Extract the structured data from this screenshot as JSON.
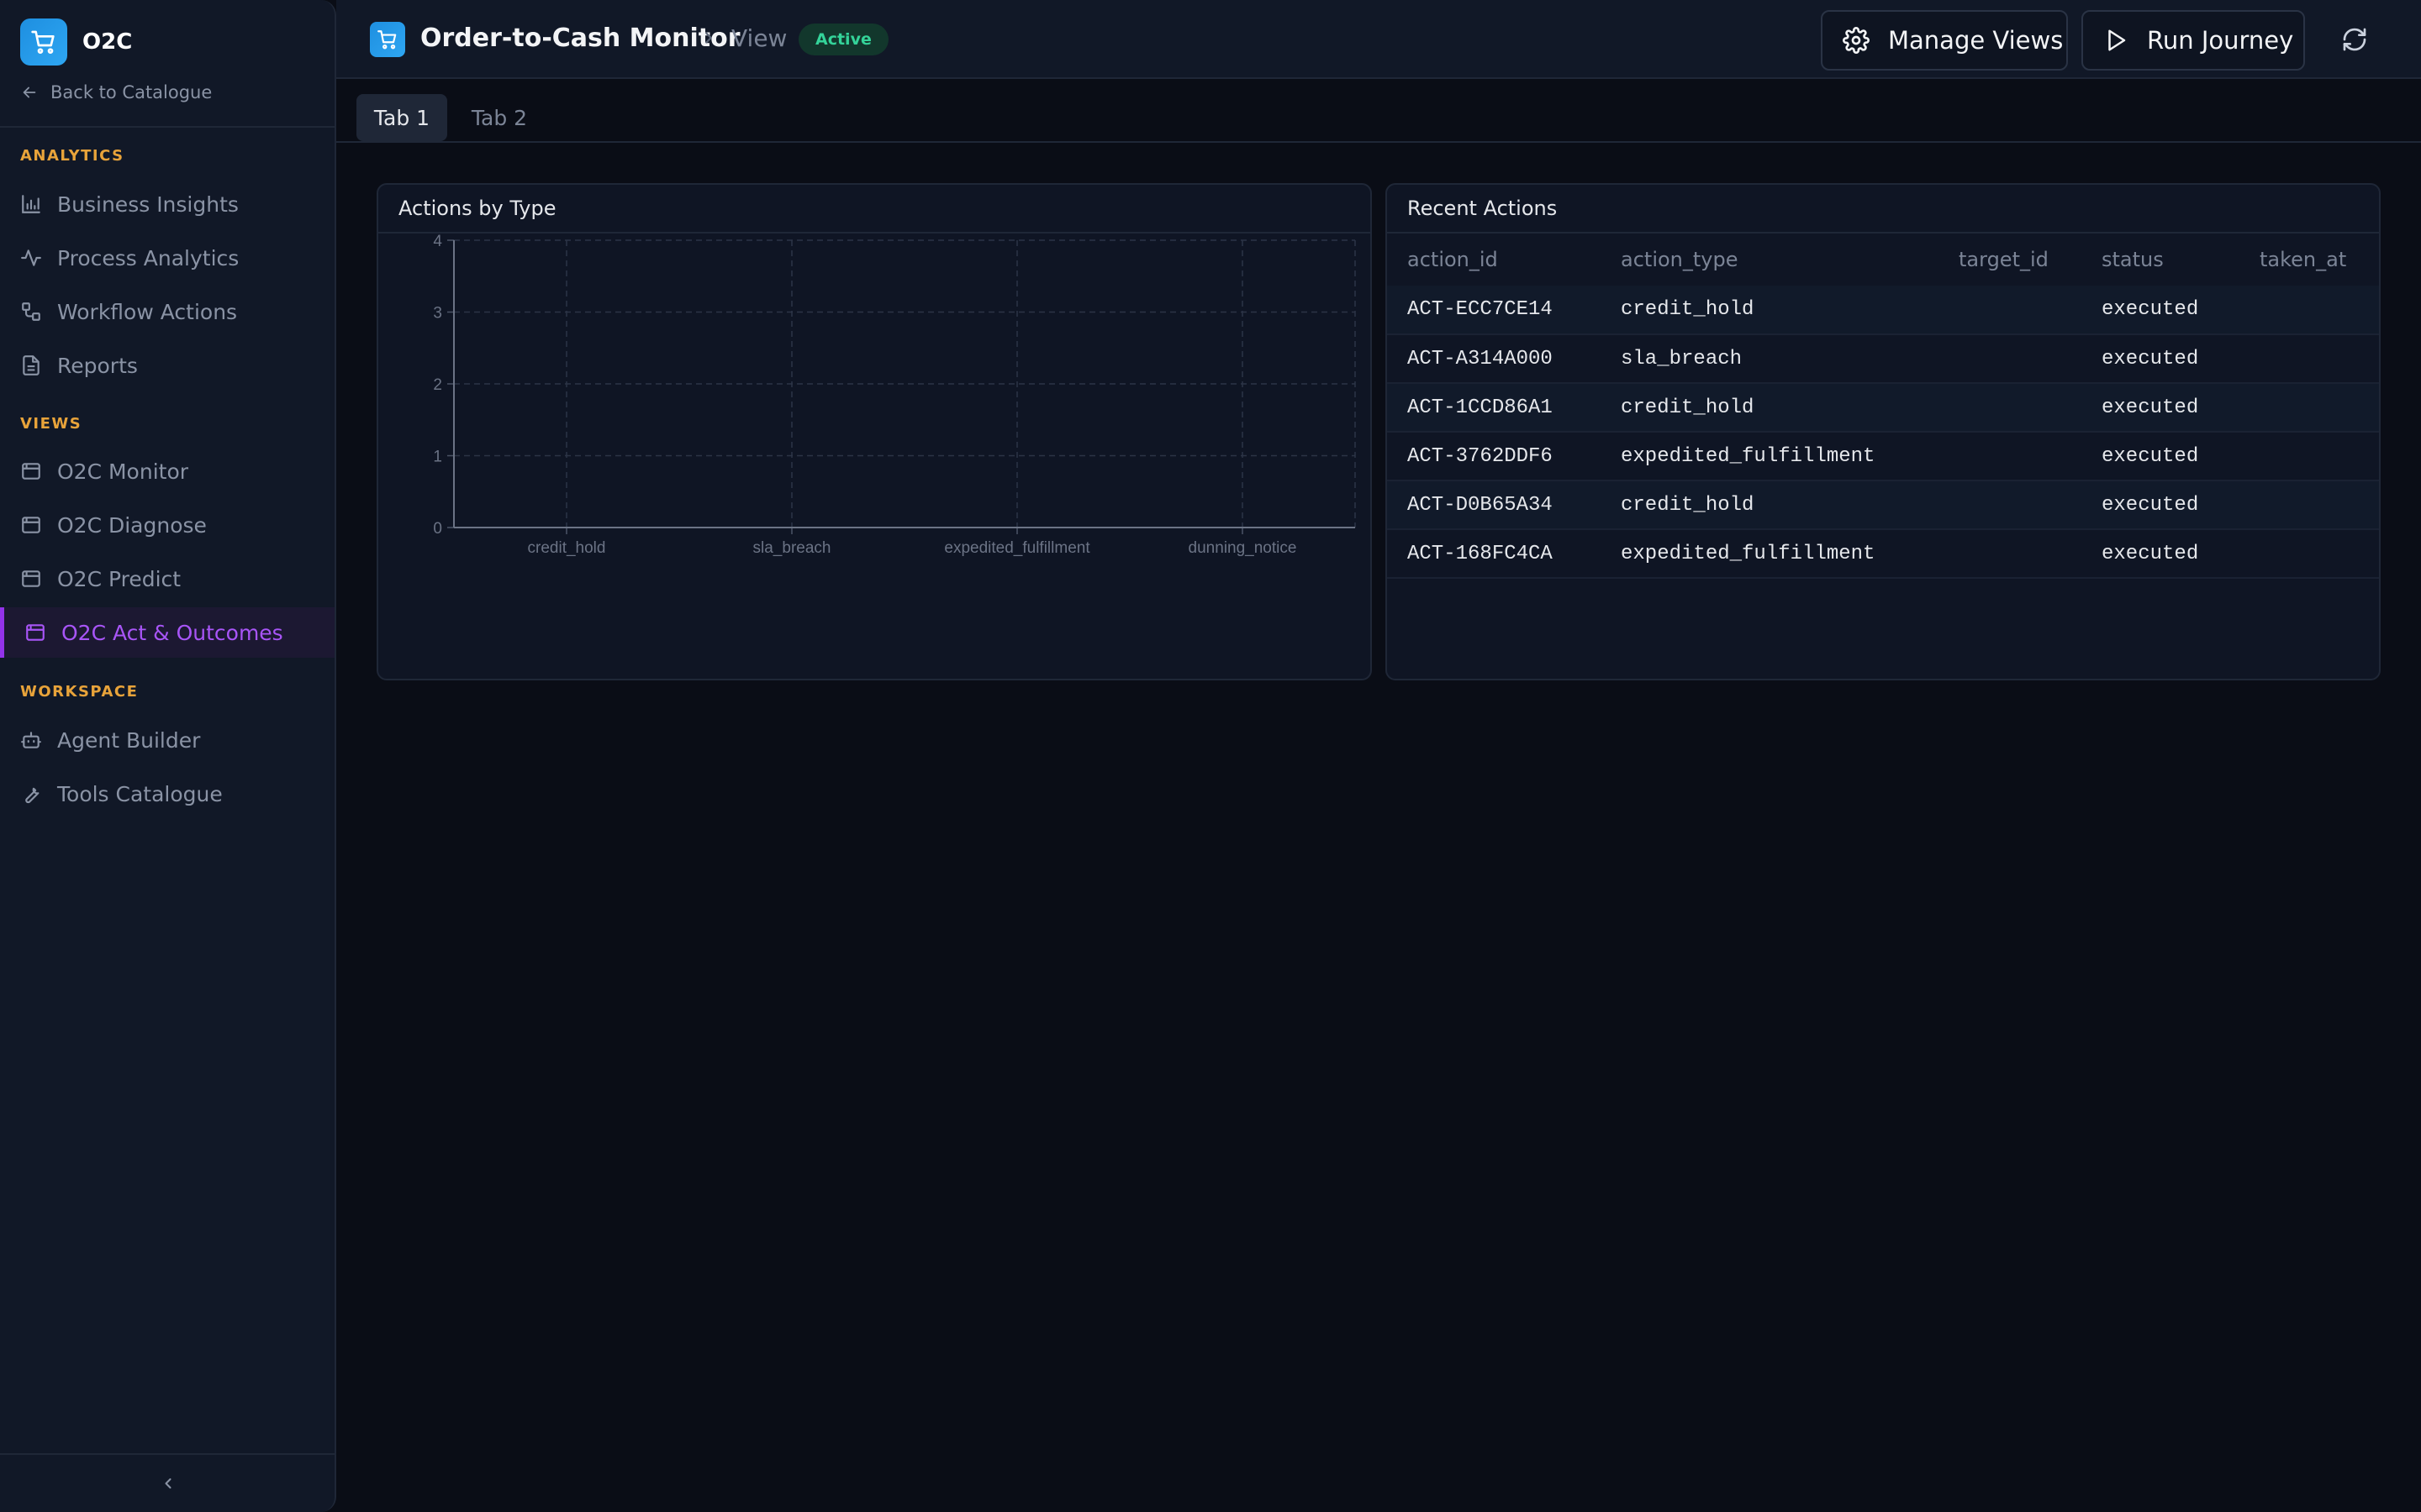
{
  "sidebar": {
    "brand": "O2C",
    "back_label": "Back to Catalogue",
    "sections": {
      "analytics": "ANALYTICS",
      "views": "VIEWS",
      "workspace": "WORKSPACE"
    },
    "analytics_items": [
      {
        "label": "Business Insights",
        "icon": "bar-chart-icon"
      },
      {
        "label": "Process Analytics",
        "icon": "activity-icon"
      },
      {
        "label": "Workflow Actions",
        "icon": "workflow-icon"
      },
      {
        "label": "Reports",
        "icon": "document-icon"
      }
    ],
    "view_items": [
      {
        "label": "O2C Monitor",
        "icon": "window-icon"
      },
      {
        "label": "O2C Diagnose",
        "icon": "window-icon"
      },
      {
        "label": "O2C Predict",
        "icon": "window-icon"
      },
      {
        "label": "O2C Act & Outcomes",
        "icon": "window-icon",
        "active": true
      }
    ],
    "workspace_items": [
      {
        "label": "Agent Builder",
        "icon": "bot-icon"
      },
      {
        "label": "Tools Catalogue",
        "icon": "wrench-icon"
      }
    ]
  },
  "header": {
    "title": "Order-to-Cash Monitor",
    "view_label": "View",
    "status_badge": "Active",
    "manage_views_label": "Manage Views",
    "run_journey_label": "Run Journey"
  },
  "tabs": [
    {
      "label": "Tab 1",
      "active": true
    },
    {
      "label": "Tab 2",
      "active": false
    }
  ],
  "chart_panel": {
    "title": "Actions by Type"
  },
  "chart_data": {
    "type": "bar",
    "title": "Actions by Type",
    "categories": [
      "credit_hold",
      "sla_breach",
      "expedited_fulfillment",
      "dunning_notice"
    ],
    "values": [
      0,
      0,
      0,
      0
    ],
    "ylim": [
      0,
      4
    ],
    "yticks": [
      "0",
      "1",
      "2",
      "3",
      "4"
    ],
    "grid": true,
    "xlabel": "",
    "ylabel": ""
  },
  "table_panel": {
    "title": "Recent Actions",
    "columns": [
      "action_id",
      "action_type",
      "target_id",
      "status",
      "taken_at"
    ],
    "rows": [
      [
        "ACT-ECC7CE14",
        "credit_hold",
        "",
        "executed",
        ""
      ],
      [
        "ACT-A314A000",
        "sla_breach",
        "",
        "executed",
        ""
      ],
      [
        "ACT-1CCD86A1",
        "credit_hold",
        "",
        "executed",
        ""
      ],
      [
        "ACT-3762DDF6",
        "expedited_fulfillment",
        "",
        "executed",
        ""
      ],
      [
        "ACT-D0B65A34",
        "credit_hold",
        "",
        "executed",
        ""
      ],
      [
        "ACT-168FC4CA",
        "expedited_fulfillment",
        "",
        "executed",
        ""
      ]
    ]
  },
  "colors": {
    "accent": "#9333ea",
    "brand": "#1e8fe0",
    "section": "#e8a33a",
    "badge": "#34d399"
  }
}
